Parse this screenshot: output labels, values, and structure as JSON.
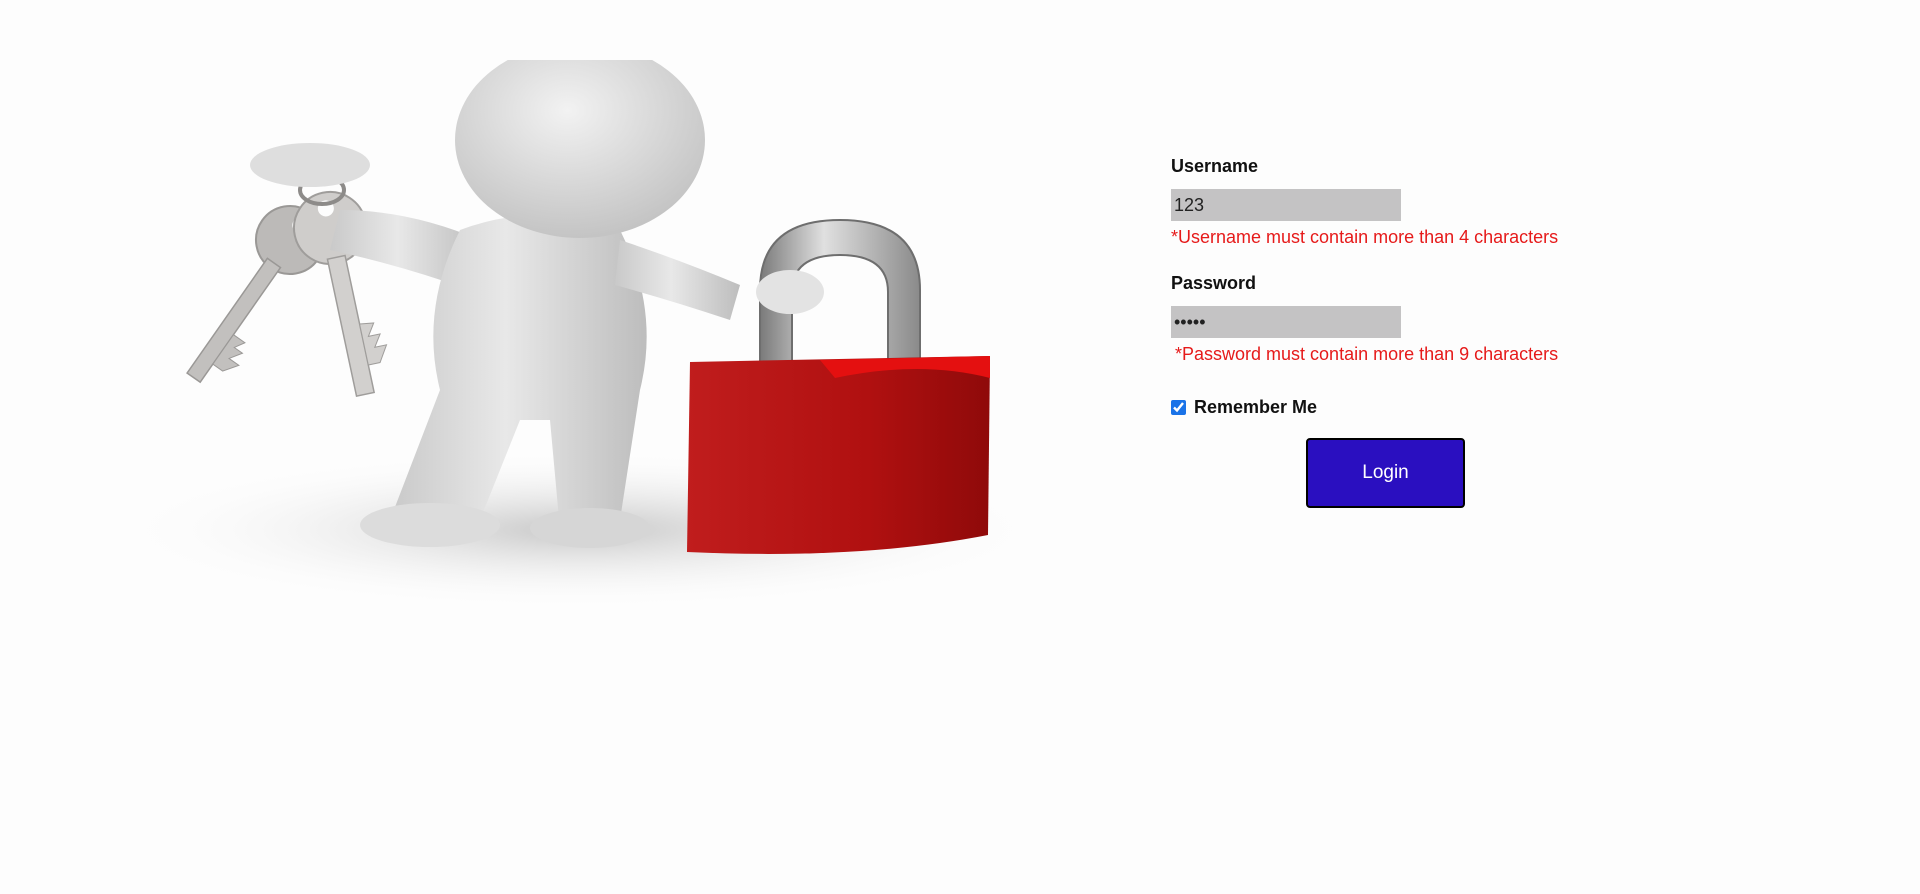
{
  "illustration": {
    "name": "figure-with-keys-and-padlock",
    "colors": {
      "figure": "#d9d9d9",
      "padlock_body": "#b71414",
      "shackle": "#a9a9a9",
      "keys": "#c4c1bf"
    }
  },
  "form": {
    "username": {
      "label": "Username",
      "value": "123",
      "error": "*Username must contain more than 4 characters"
    },
    "password": {
      "label": "Password",
      "value": "•••••",
      "error": "*Password must contain more than 9 characters"
    },
    "remember": {
      "label": "Remember Me",
      "checked": true
    },
    "login_label": "Login"
  },
  "colors": {
    "error": "#e61a1a",
    "button": "#2a0fc0",
    "input_bg": "#c4c3c4"
  }
}
